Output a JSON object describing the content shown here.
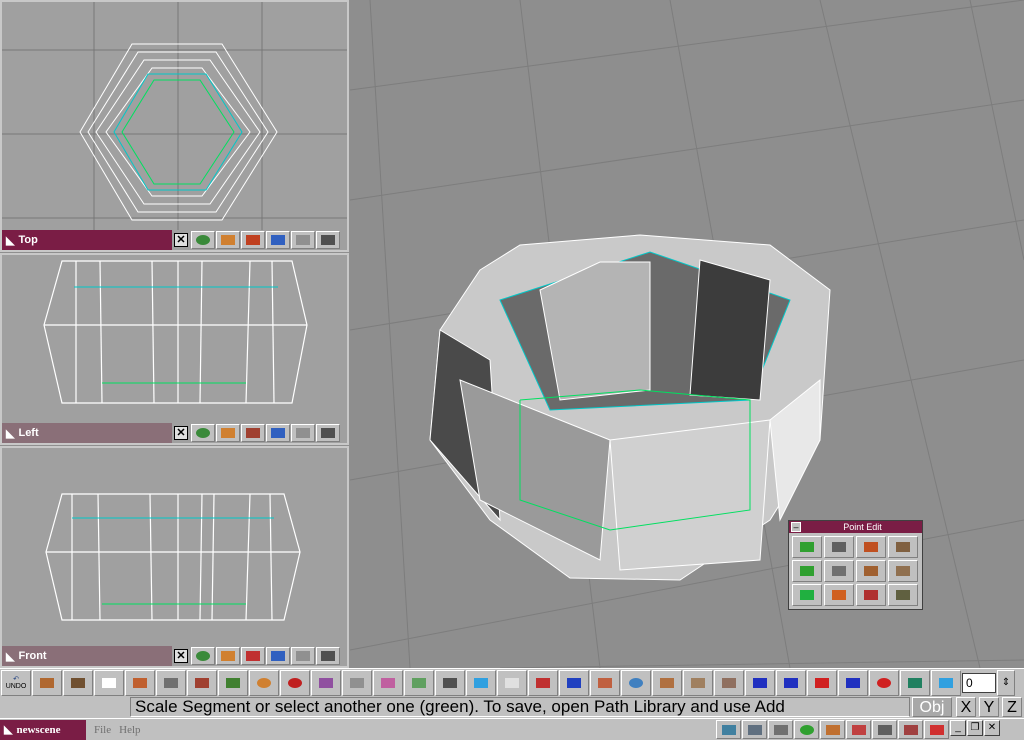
{
  "viewports": [
    {
      "name": "Top",
      "title_bg": "#7a1d45"
    },
    {
      "name": "Left",
      "title_bg": "#8a6f78"
    },
    {
      "name": "Front",
      "title_bg": "#8a6f78"
    }
  ],
  "viewport_close": "✕",
  "point_edit": {
    "title": "Point Edit",
    "minimize": "–"
  },
  "toolbar": {
    "undo_label": "UNDO",
    "frame_value": "0"
  },
  "status": {
    "message": "Scale Segment or select another one (green). To save, open Path Library and use Add",
    "mode": "Obj",
    "axis_x": "X",
    "axis_y": "Y",
    "axis_z": "Z"
  },
  "taskbar": {
    "app_name": "newscene",
    "menu_file": "File",
    "menu_help": "Help"
  },
  "colors": {
    "accent": "#7a1d45",
    "wire": "#ffffff",
    "selection": "#00c8c8",
    "segment": "#00e060"
  }
}
